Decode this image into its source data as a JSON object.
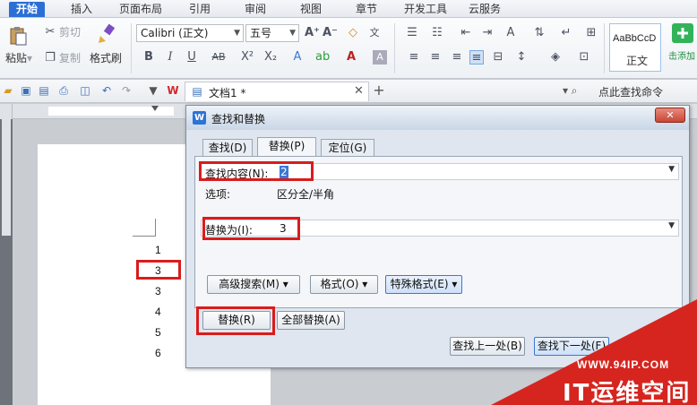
{
  "menubar": {
    "tabs": [
      "开始",
      "插入",
      "页面布局",
      "引用",
      "审阅",
      "视图",
      "章节",
      "开发工具",
      "云服务"
    ]
  },
  "ribbon": {
    "paste": "粘贴",
    "cut": "剪切",
    "copy": "复制",
    "format_painter": "格式刷",
    "font_name": "Calibri (正文)",
    "font_size": "五号",
    "style_preview": "AaBbCcD",
    "style_name": "正文",
    "addon": "击添加"
  },
  "quickbar": {
    "doc_tab": "文档1 *",
    "search_cmd": "点此查找命令"
  },
  "document": {
    "numbers": [
      "1",
      "3",
      "3",
      "4",
      "5",
      "6"
    ]
  },
  "dialog": {
    "title": "查找和替换",
    "tabs": [
      "查找(D)",
      "替换(P)",
      "定位(G)"
    ],
    "find_label": "查找内容(N):",
    "find_value": "2",
    "options_label": "选项:",
    "options_value": "区分全/半角",
    "replace_label": "替换为(I):",
    "replace_value": "3",
    "adv_search": "高级搜索(M) ▾",
    "format_btn": "格式(O) ▾",
    "special_btn": "特殊格式(E) ▾",
    "replace_btn": "替换(R)",
    "replace_all_btn": "全部替换(A)",
    "find_prev_btn": "查找上一处(B)",
    "find_next_btn": "查找下一处(F)"
  },
  "watermark": {
    "url": "WWW.94IP.COM",
    "brand": "IT运维空间"
  },
  "colors": {
    "accent": "#2b6fd6",
    "highlight_red": "#d91c1c",
    "watermark_red": "#d6251f"
  }
}
